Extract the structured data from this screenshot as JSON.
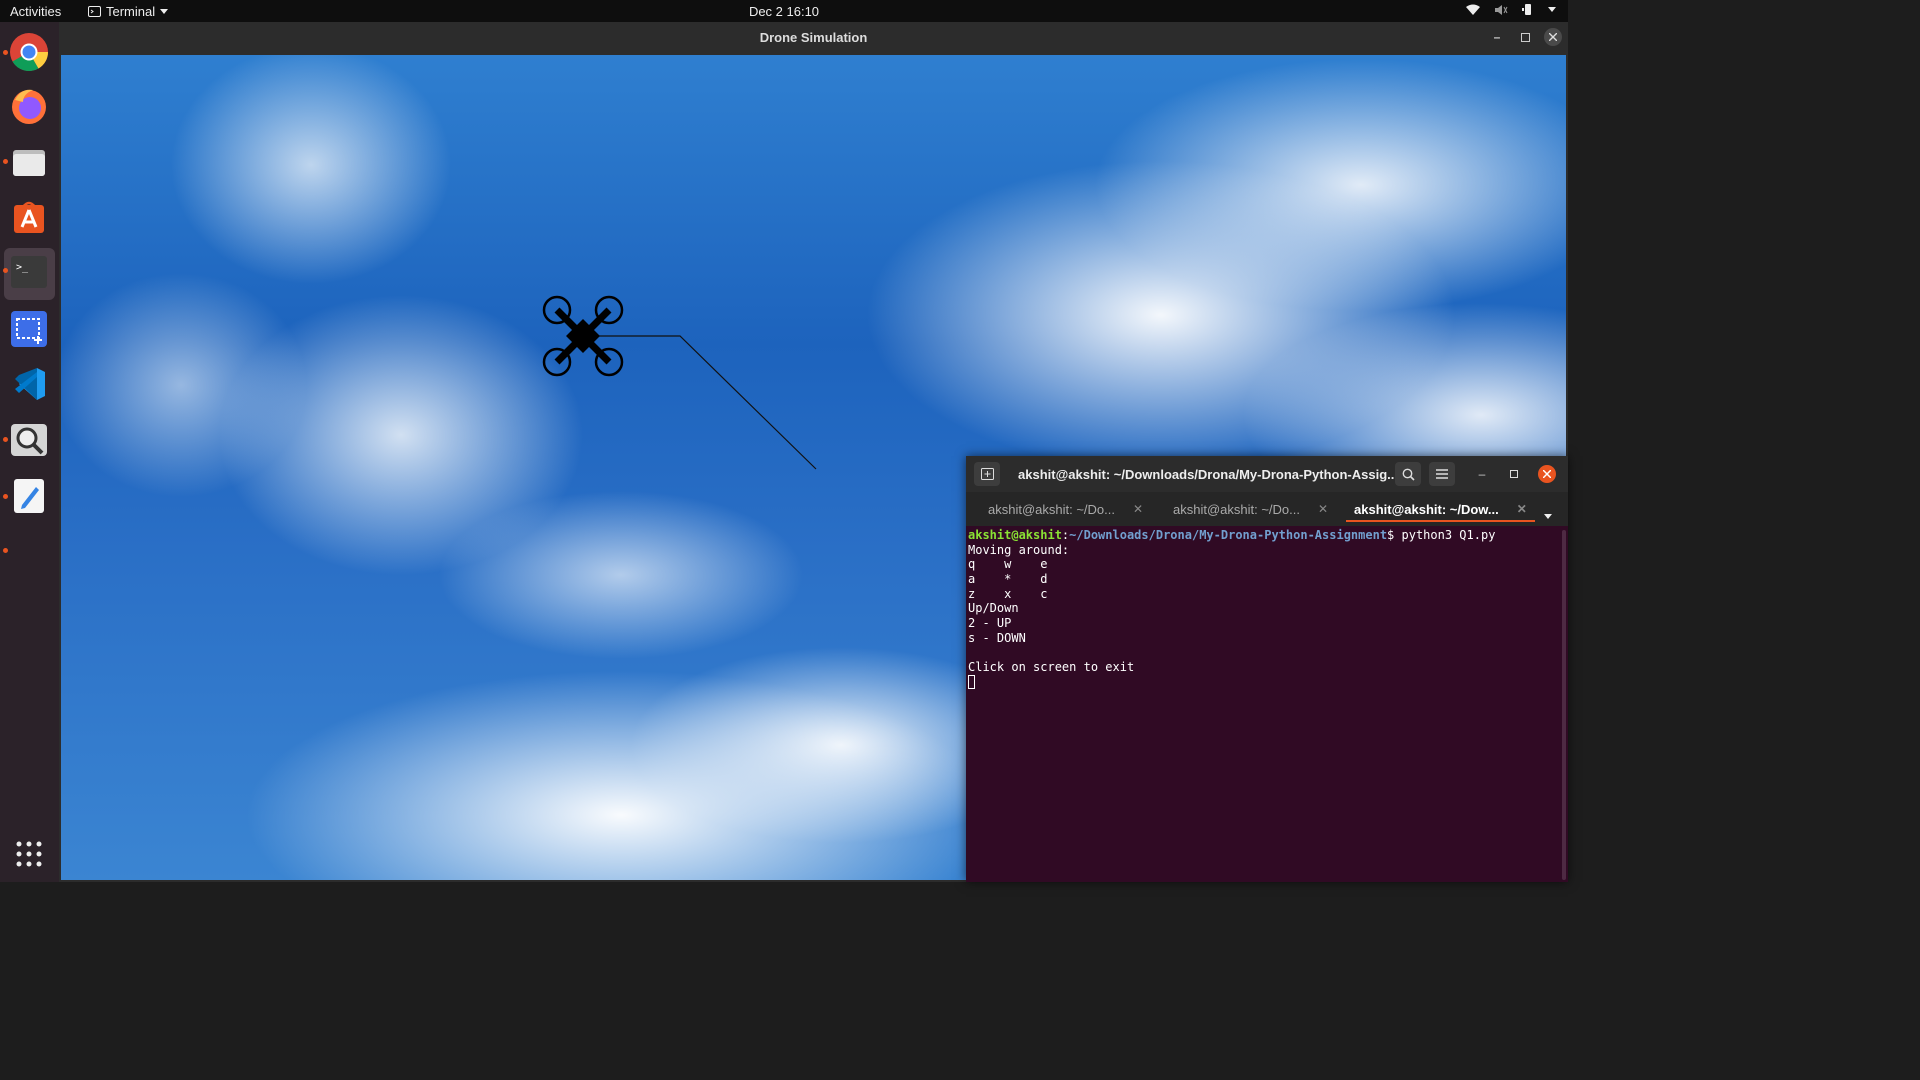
{
  "topbar": {
    "activities": "Activities",
    "app_name": "Terminal",
    "clock": "Dec 2  16:10",
    "tray_icons": [
      "wifi-icon",
      "volume-icon",
      "battery-icon",
      "power-menu-icon"
    ]
  },
  "dock": {
    "items": [
      "chrome",
      "firefox",
      "files",
      "ubuntu-software",
      "terminal",
      "screenshot",
      "vscode",
      "magnifier",
      "text-editor"
    ],
    "show_apps": "show-applications-icon"
  },
  "sim_window": {
    "title": "Drone Simulation"
  },
  "terminal": {
    "title": "akshit@akshit: ~/Downloads/Drona/My-Drona-Python-Assig...",
    "tabs": [
      {
        "label": "akshit@akshit: ~/Do..."
      },
      {
        "label": "akshit@akshit: ~/Do..."
      },
      {
        "label": "akshit@akshit: ~/Dow..."
      }
    ],
    "prompt_user": "akshit@akshit",
    "prompt_path": "~/Downloads/Drona/My-Drona-Python-Assignment",
    "prompt_cmd": "$ python3 Q1.py",
    "output": [
      "Moving around:",
      "q    w    e",
      "a    *    d",
      "z    x    c",
      "Up/Down",
      "2 - UP",
      "s - DOWN",
      "",
      "Click on screen to exit"
    ]
  },
  "colors": {
    "accent": "#e95420",
    "terminal_bg": "#300a24",
    "prompt_user": "#8ae234",
    "prompt_path": "#729fcf"
  }
}
